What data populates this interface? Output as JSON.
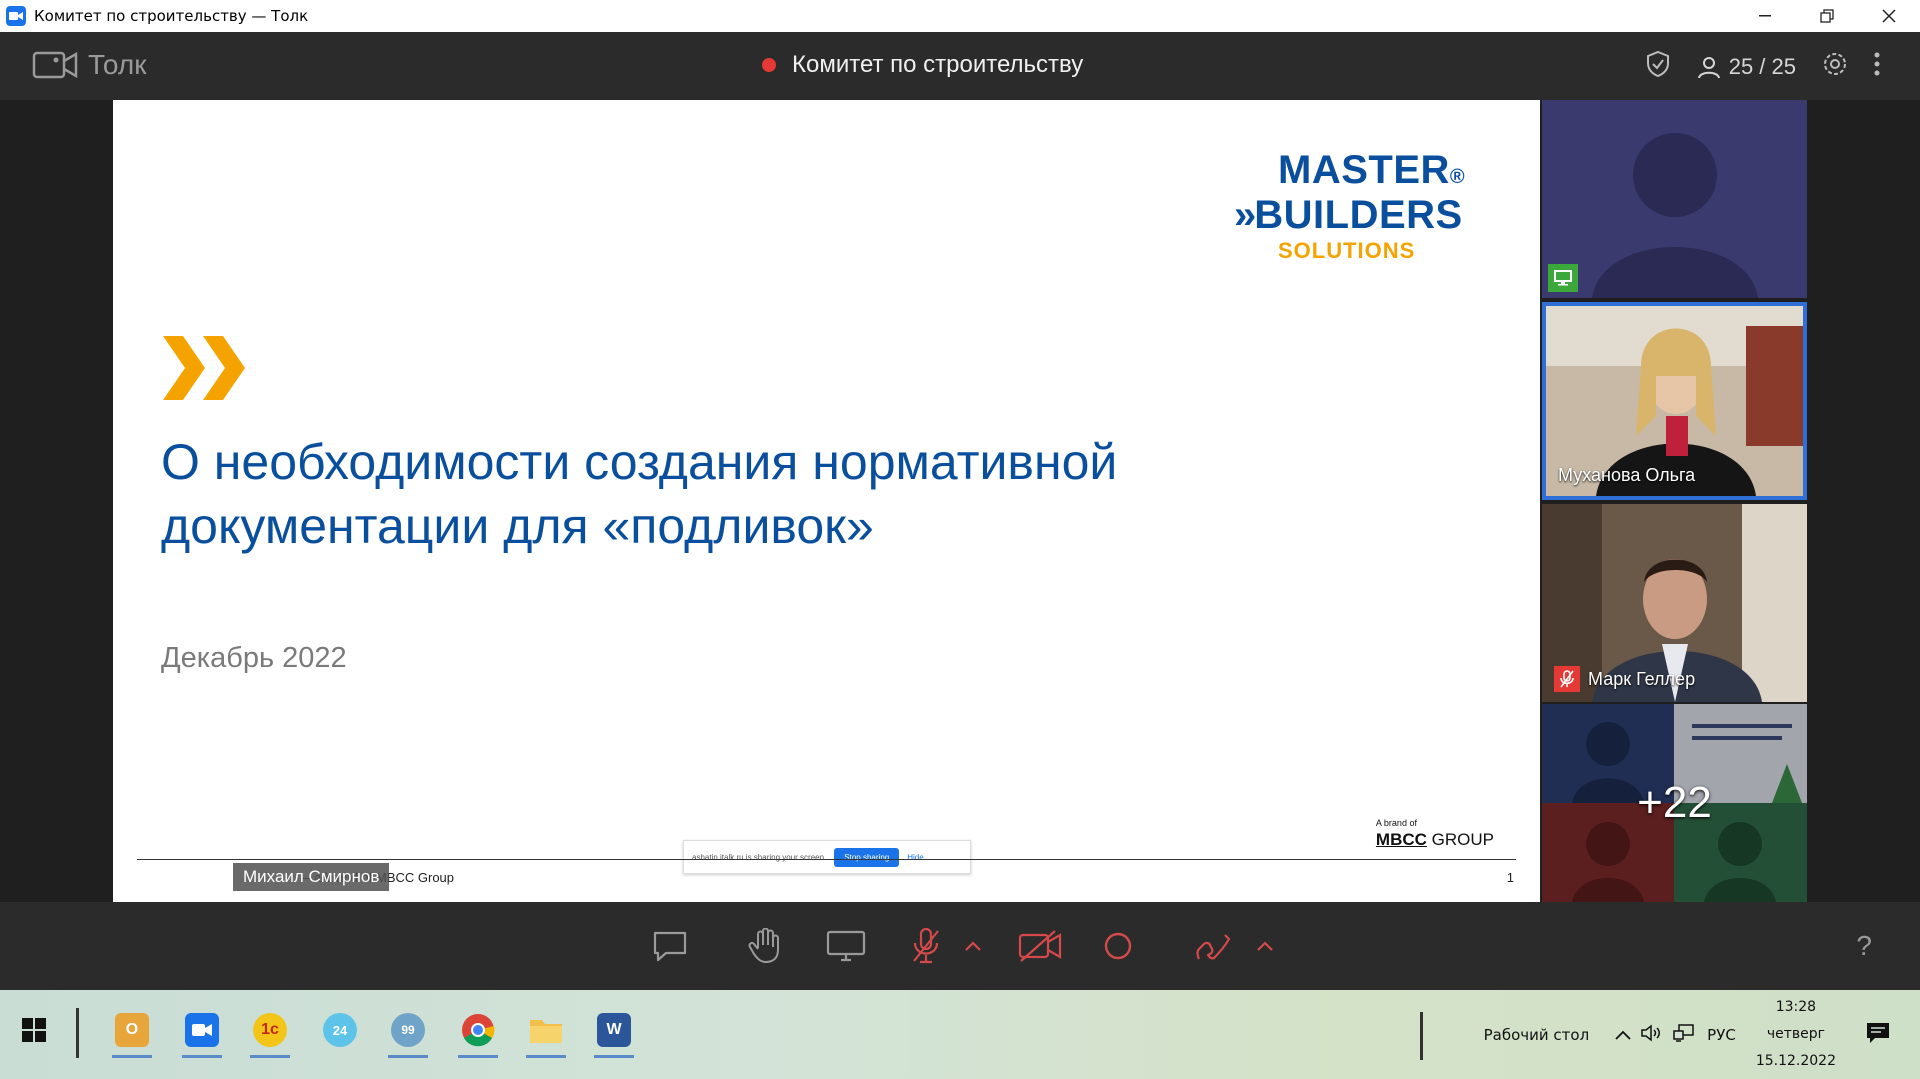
{
  "window": {
    "title": "Комитет по строительству — Толк"
  },
  "talk": {
    "app_name": "Толк",
    "meeting_title": "Комитет по строительству",
    "participants": "25 / 25"
  },
  "slide": {
    "logo_line1": "MASTER",
    "logo_reg": "®",
    "logo_line2": "BUILDERS",
    "logo_line3": "SOLUTIONS",
    "title": "О необходимости создания нормативной документации для «подливок»",
    "date": "Декабрь 2022",
    "footer": "– a brand of MBCC Group",
    "page": "1",
    "brand_small": "A brand of",
    "brand_mbcc": "MBCC",
    "brand_group": "GROUP",
    "share_text": "ashatin.italk.ru is sharing your screen.",
    "share_stop": "Stop sharing",
    "share_hide": "Hide"
  },
  "speaker": {
    "name": "Михаил Смирнов"
  },
  "tiles": [
    {
      "name": ""
    },
    {
      "name": "Муханова Ольга"
    },
    {
      "name": "Марк Геллер"
    },
    {
      "name": "+22"
    }
  ],
  "taskbar": {
    "desktop_label": "Рабочий стол",
    "lang": "РУС",
    "time": "13:28",
    "day": "четверг",
    "date": "15.12.2022"
  },
  "colors": {
    "brand_blue": "#0a4f9e",
    "brand_orange": "#f5a300",
    "record_red": "#e53935"
  }
}
